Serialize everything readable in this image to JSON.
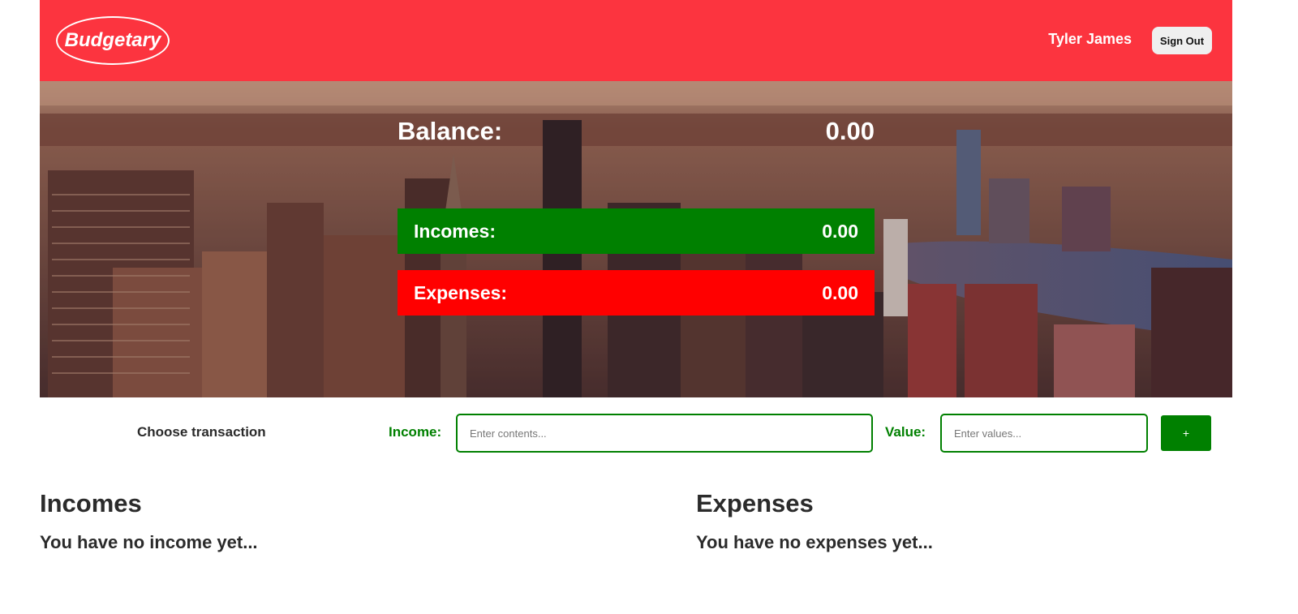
{
  "header": {
    "logo": "Budgetary",
    "user_name": "Tyler James",
    "signout_label": "Sign Out"
  },
  "summary": {
    "balance_label": "Balance:",
    "balance_value": "0.00",
    "incomes_label": "Incomes:",
    "incomes_value": "0.00",
    "expenses_label": "Expenses:",
    "expenses_value": "0.00"
  },
  "form": {
    "choose_label": "Choose transaction",
    "type_label": "Income:",
    "contents_placeholder": "Enter contents...",
    "value_label": "Value:",
    "value_placeholder": "Enter values...",
    "add_label": "+"
  },
  "lists": {
    "incomes_title": "Incomes",
    "incomes_empty": "You have no income yet...",
    "expenses_title": "Expenses",
    "expenses_empty": "You have no expenses yet..."
  },
  "colors": {
    "header": "#fc343f",
    "income": "#008000",
    "expense": "#ff0000"
  }
}
